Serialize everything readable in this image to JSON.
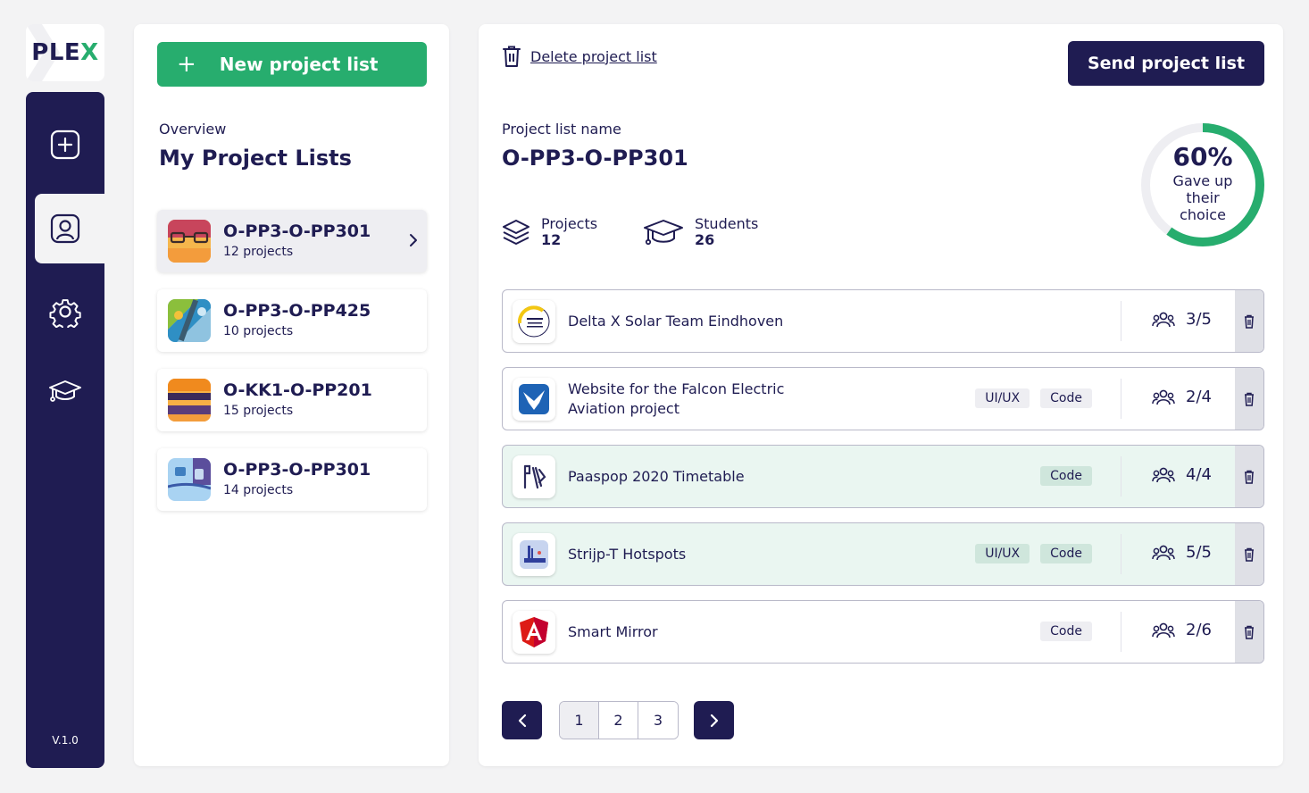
{
  "brand": {
    "logo_main": "PLE",
    "logo_accent": "X",
    "version": "V.1.0",
    "colors": {
      "navy": "#1f1c52",
      "green": "#27ad6e",
      "background": "#f3f3f4"
    }
  },
  "rail": {
    "items": [
      {
        "icon": "plus-square-icon"
      },
      {
        "icon": "user-profile-icon",
        "active": true
      },
      {
        "icon": "gear-icon"
      },
      {
        "icon": "graduation-cap-icon"
      }
    ]
  },
  "sidebar": {
    "new_button_label": "New project list",
    "overview_label": "Overview",
    "title": "My Project Lists",
    "lists": [
      {
        "name": "O-PP3-O-PP301",
        "count": "12 projects",
        "active": true
      },
      {
        "name": "O-PP3-O-PP425",
        "count": "10 projects"
      },
      {
        "name": "O-KK1-O-PP201",
        "count": "15 projects"
      },
      {
        "name": "O-PP3-O-PP301",
        "count": "14 projects"
      }
    ]
  },
  "main": {
    "delete_label": "Delete project list",
    "send_label": "Send project list",
    "list_name_label": "Project list name",
    "list_name": "O-PP3-O-PP301",
    "stats": {
      "projects_label": "Projects",
      "projects_value": "12",
      "students_label": "Students",
      "students_value": "26"
    },
    "gauge": {
      "percent_text": "60%",
      "percent_value": 60,
      "caption_1": "Gave up",
      "caption_2": "their",
      "caption_3": "choice"
    },
    "projects": [
      {
        "title_1": "Delta X Solar Team Eindhoven",
        "title_2": "",
        "tags": [],
        "capacity": "3/5",
        "highlighted": false,
        "icon": "solar-team-logo"
      },
      {
        "title_1": "Website for the Falcon Electric",
        "title_2": "Aviation project",
        "tags": [
          "UI/UX",
          "Code"
        ],
        "capacity": "2/4",
        "highlighted": false,
        "icon": "falcon-logo"
      },
      {
        "title_1": "Paaspop 2020 Timetable",
        "title_2": "",
        "tags": [
          "Code"
        ],
        "capacity": "4/4",
        "highlighted": true,
        "icon": "paaspop-logo"
      },
      {
        "title_1": "Strijp-T Hotspots",
        "title_2": "",
        "tags": [
          "UI/UX",
          "Code"
        ],
        "capacity": "5/5",
        "highlighted": true,
        "icon": "strijp-logo"
      },
      {
        "title_1": "Smart Mirror",
        "title_2": "",
        "tags": [
          "Code"
        ],
        "capacity": "2/6",
        "highlighted": false,
        "icon": "angular-logo"
      }
    ],
    "pagination": {
      "pages": [
        "1",
        "2",
        "3"
      ],
      "current": "1"
    }
  }
}
